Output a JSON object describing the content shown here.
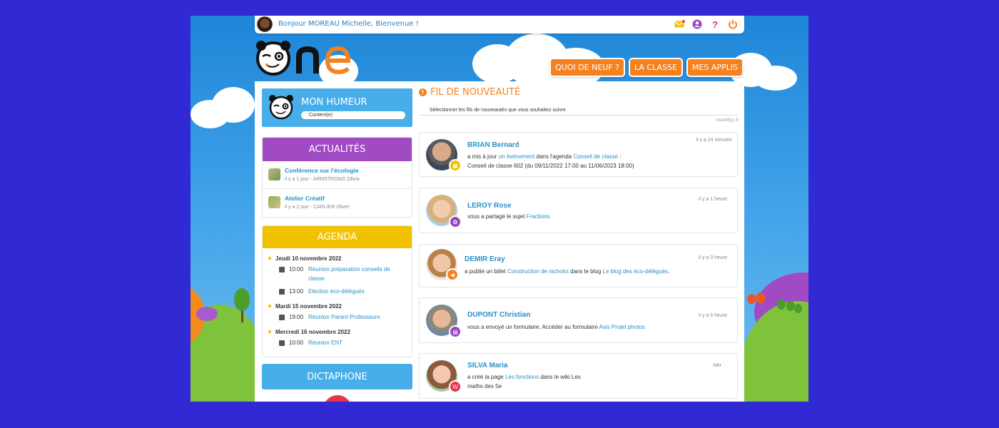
{
  "topbar": {
    "greeting": "Bonjour MOREAU Michelle, Bienvenue !",
    "icons": [
      "mail-icon",
      "account-icon",
      "help-icon",
      "power-icon"
    ]
  },
  "logo_text": "One",
  "nav": [
    {
      "label": "QUOI DE NEUF ?"
    },
    {
      "label": "LA CLASSE"
    },
    {
      "label": "MES APPLIS"
    }
  ],
  "humeur": {
    "title": "MON HUMEUR",
    "value": "Content(e)"
  },
  "actualites": {
    "title": "ACTUALITÉS",
    "items": [
      {
        "title": "Conférence sur l'écologie",
        "meta": "il y a 1 jour - ARMSTRONG Olivia"
      },
      {
        "title": "Atelier Créatif",
        "meta": "il y a 2 jour - CARLIER Oliver"
      }
    ]
  },
  "agenda": {
    "title": "AGENDA",
    "days": [
      {
        "date": "Jeudi 10 novembre 2022",
        "events": [
          {
            "time": "10:00",
            "title": "Réunion préparation conseils de classe"
          },
          {
            "time": "13:00",
            "title": "Election éco-délégués"
          }
        ]
      },
      {
        "date": "Mardi 15 novembre 2022",
        "events": [
          {
            "time": "19:00",
            "title": "Réunion Parent Professeurs"
          }
        ]
      },
      {
        "date": "Mercredi 16 novembre 2022",
        "events": [
          {
            "time": "10:00",
            "title": "Réunion ENT"
          }
        ]
      }
    ]
  },
  "dictaphone": {
    "title": "DICTAPHONE"
  },
  "feed": {
    "title": "FIL DE NOUVEAUTÉ",
    "select_label": "Sélectionner les fils de nouveautés que vous souhaitez suivre",
    "inactive": "Inactif(s) 3",
    "posts": [
      {
        "author": "BRIAN Bernard",
        "time": "il y a 24 minutes",
        "line1_pre": "a mis à jour",
        "line1_link1": "un événement",
        "line1_mid": "dans l'agenda",
        "line1_link2": "Conseil de classe",
        "line1_post": ":",
        "line2": "Conseil de classe 602 (du 09/11/2022 17:00 au 11/06/2023 18:00)",
        "badge_icon": "calendar-icon",
        "badge_color": "#f2c200"
      },
      {
        "author": "LEROY Rose",
        "time": "il y a 1 heure",
        "line1_pre": "vous a partagé le sujet",
        "line1_link1": "Fractions",
        "badge_icon": "exercise-icon",
        "badge_color": "#9b45c2"
      },
      {
        "author": "DEMIR Eray",
        "time": "il y a 3 heure",
        "line1_pre": "a publié un billet",
        "line1_link1": "Construction de nichoirs",
        "line1_mid": "dans le blog",
        "line1_link2": "Le blog des éco-délégués",
        "line1_post": ".",
        "badge_icon": "megaphone-icon",
        "badge_color": "#f58220"
      },
      {
        "author": "DUPONT Christian",
        "time": "il y a 6 heure",
        "line1_pre": "vous a envoyé un formulaire. Accéder au formulaire",
        "line1_link1": "Avis Projet photos",
        "badge_icon": "form-icon",
        "badge_color": "#9b45c2"
      },
      {
        "author": "SILVA Maria",
        "time": "hier",
        "line1_pre": "a créé la page",
        "line1_link1": "Les fonctions",
        "line1_mid": "dans le wiki Les",
        "line2": "maths des 5e",
        "badge_icon": "wiki-icon",
        "badge_color": "#e8354a"
      }
    ]
  },
  "colors": {
    "accent": "#f58220",
    "link": "#2a8fc6",
    "humeur": "#47aee9",
    "actualites": "#a04ac4",
    "agenda": "#f2c200",
    "dictaphone": "#47aee9"
  }
}
